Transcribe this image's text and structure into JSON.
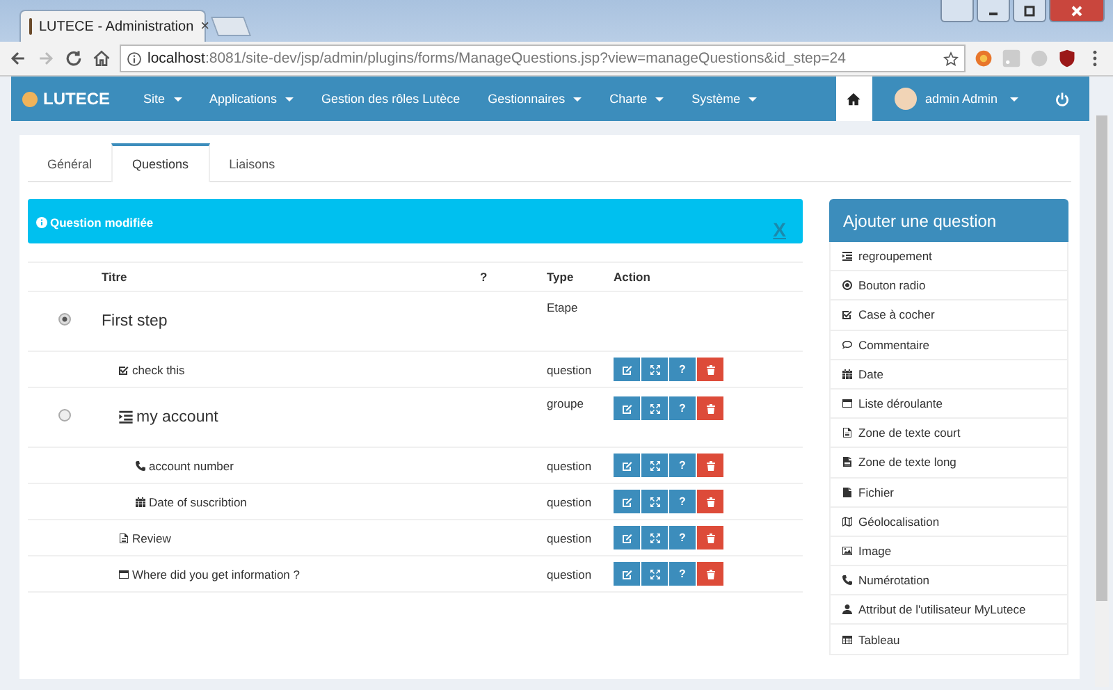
{
  "browser": {
    "tab_title": "LUTECE - Administration",
    "tab_close": "×",
    "url_host": "localhost",
    "url_rest": ":8081/site-dev/jsp/admin/plugins/forms/ManageQuestions.jsp?view=manageQuestions&id_step=24"
  },
  "navbar": {
    "brand": "LUTECE",
    "items": [
      {
        "label": "Site",
        "dropdown": true
      },
      {
        "label": "Applications",
        "dropdown": true
      },
      {
        "label": "Gestion des rôles Lutèce",
        "dropdown": false
      },
      {
        "label": "Gestionnaires",
        "dropdown": true
      },
      {
        "label": "Charte",
        "dropdown": true
      },
      {
        "label": "Système",
        "dropdown": true
      }
    ],
    "user": "admin Admin"
  },
  "tabs": [
    {
      "label": "Général",
      "selected": false
    },
    {
      "label": "Questions",
      "selected": true
    },
    {
      "label": "Liaisons",
      "selected": false
    }
  ],
  "alert": {
    "message": "Question modifiée",
    "close": "X"
  },
  "table": {
    "columns": [
      "Titre",
      "?",
      "Type",
      "Action"
    ],
    "rows": [
      {
        "title": "First step",
        "type": "Etape",
        "radio": true,
        "selected": true,
        "children": [
          {
            "title": "check this",
            "kind": "checkbox",
            "type": "question",
            "help": "?"
          },
          {
            "title": "my account",
            "kind": "group",
            "type": "groupe",
            "radio": true,
            "selected": false,
            "help": "?",
            "children": [
              {
                "title": "account number",
                "kind": "phone",
                "type": "question",
                "help": "?"
              },
              {
                "title": "Date of suscribtion",
                "kind": "calendar",
                "type": "question",
                "help": "?"
              }
            ]
          },
          {
            "title": "Review",
            "kind": "file-text",
            "type": "question",
            "help": "?"
          },
          {
            "title": "Where did you get information ?",
            "kind": "list",
            "type": "question",
            "help": "?"
          }
        ]
      }
    ]
  },
  "sidebar": {
    "title": "Ajouter une question",
    "items": [
      {
        "label": "regroupement",
        "kind": "group"
      },
      {
        "label": "Bouton radio",
        "kind": "radio"
      },
      {
        "label": "Case à cocher",
        "kind": "checkbox"
      },
      {
        "label": "Commentaire",
        "kind": "comment"
      },
      {
        "label": "Date",
        "kind": "calendar"
      },
      {
        "label": "Liste déroulante",
        "kind": "list"
      },
      {
        "label": "Zone de texte court",
        "kind": "file-text"
      },
      {
        "label": "Zone de texte long",
        "kind": "file-lines"
      },
      {
        "label": "Fichier",
        "kind": "file"
      },
      {
        "label": "Géolocalisation",
        "kind": "map"
      },
      {
        "label": "Image",
        "kind": "image"
      },
      {
        "label": "Numérotation",
        "kind": "phone"
      },
      {
        "label": "Attribut de l'utilisateur MyLutece",
        "kind": "user"
      },
      {
        "label": "Tableau",
        "kind": "table"
      }
    ]
  }
}
